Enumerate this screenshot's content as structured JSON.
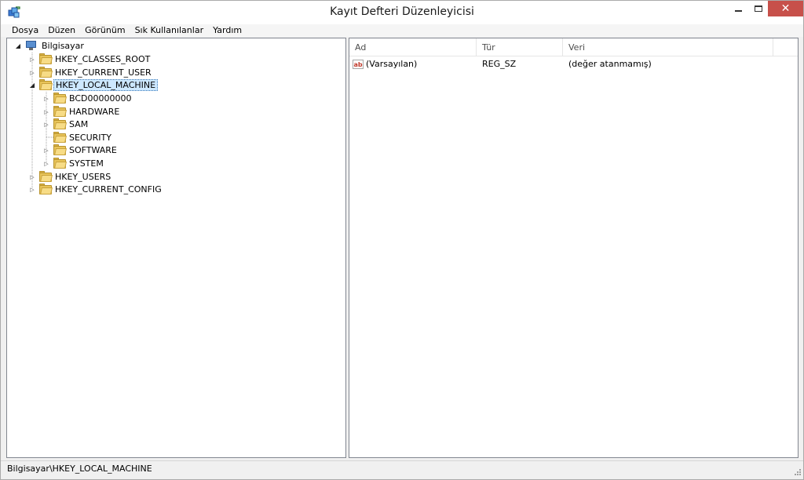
{
  "window": {
    "title": "Kayıt Defteri Düzenleyicisi",
    "close_color": "#c7504a"
  },
  "menu": [
    "Dosya",
    "Düzen",
    "Görünüm",
    "Sık Kullanılanlar",
    "Yardım"
  ],
  "tree": {
    "root": "Bilgisayar",
    "hives": [
      {
        "label": "HKEY_CLASSES_ROOT"
      },
      {
        "label": "HKEY_CURRENT_USER"
      },
      {
        "label": "HKEY_LOCAL_MACHINE",
        "expanded": true,
        "selected": true
      },
      {
        "label": "HKEY_USERS"
      },
      {
        "label": "HKEY_CURRENT_CONFIG"
      }
    ],
    "local_machine_children": [
      {
        "label": "BCD00000000"
      },
      {
        "label": "HARDWARE"
      },
      {
        "label": "SAM"
      },
      {
        "label": "SECURITY"
      },
      {
        "label": "SOFTWARE"
      },
      {
        "label": "SYSTEM"
      }
    ]
  },
  "list": {
    "columns": [
      "Ad",
      "Tür",
      "Veri"
    ],
    "rows": [
      {
        "name": "(Varsayılan)",
        "type": "REG_SZ",
        "data": "(değer atanmamış)",
        "icon": "ab-string-icon"
      }
    ]
  },
  "status": {
    "path": "Bilgisayar\\HKEY_LOCAL_MACHINE"
  },
  "colors": {
    "selection": "#cde8ff",
    "folder": "#e8c45a"
  }
}
